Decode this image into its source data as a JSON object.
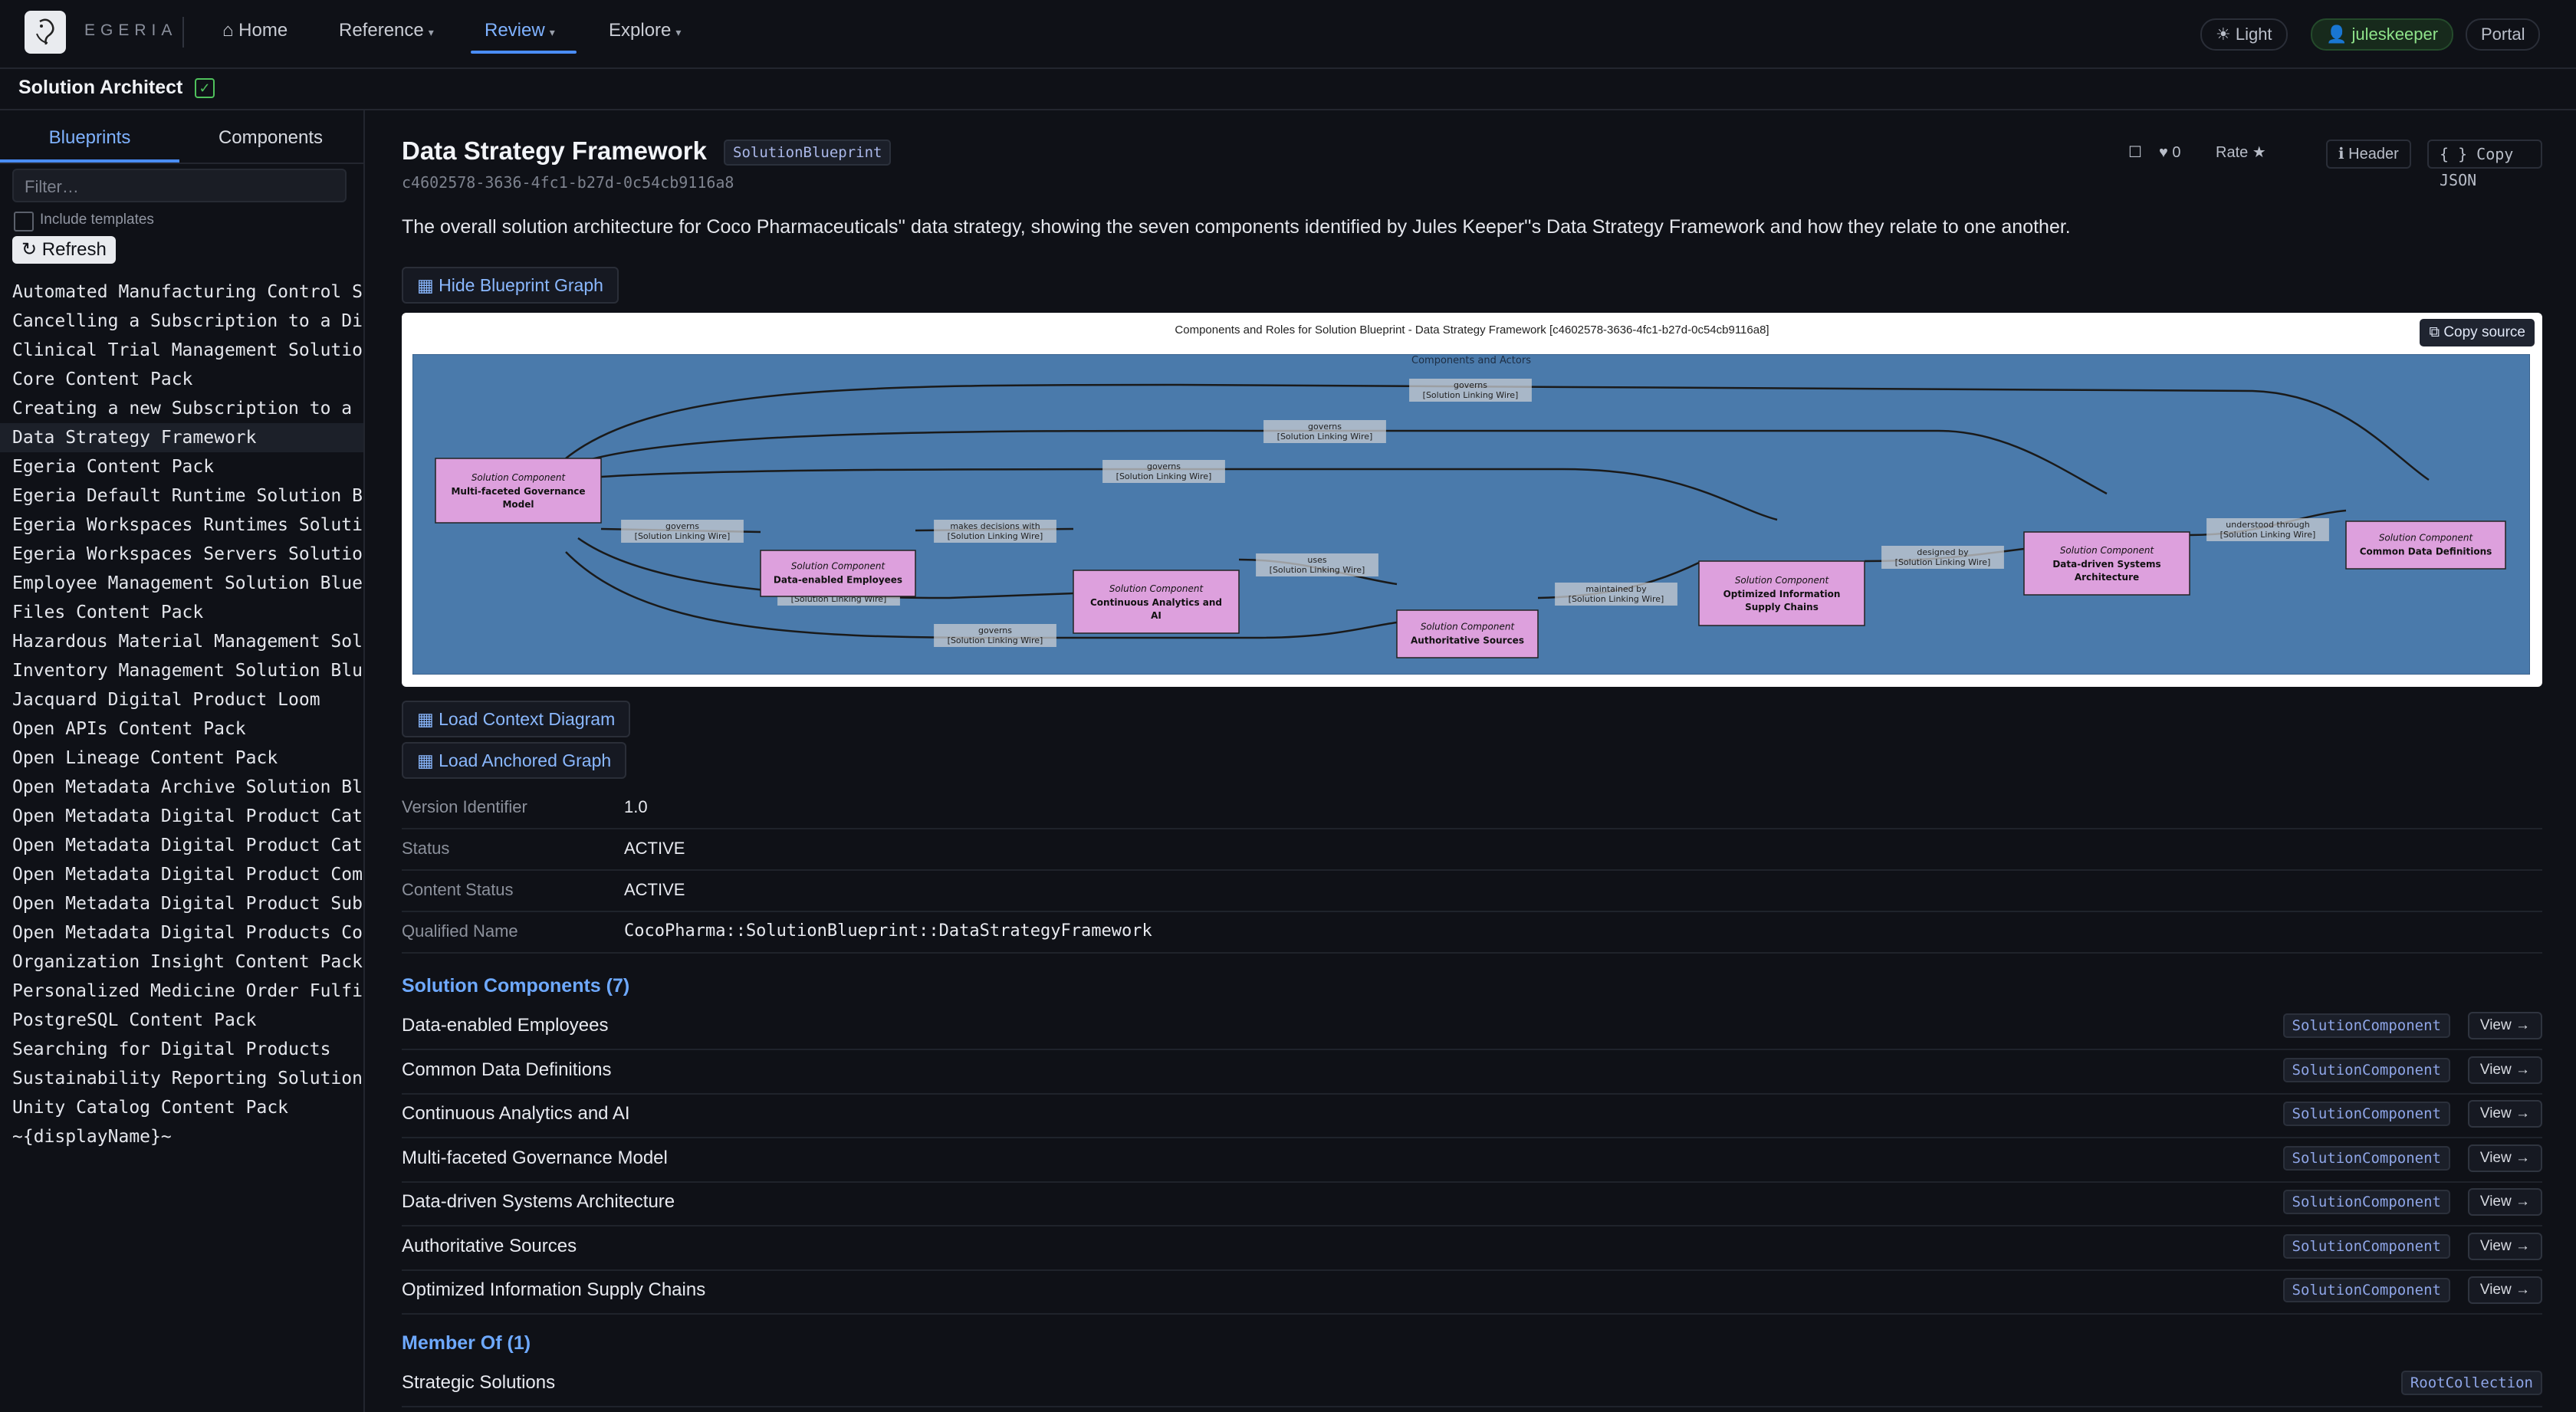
{
  "nav": {
    "brand": "EGERIA",
    "home": "⌂ Home",
    "reference": "Reference",
    "review": "Review",
    "explore": "Explore",
    "caret": "▾",
    "theme": "☀ Light",
    "user": "👤 juleskeeper",
    "portal": "Portal"
  },
  "subheader": {
    "title": "Solution Architect",
    "check": "✓"
  },
  "sidebar": {
    "tabs": [
      "Blueprints",
      "Components"
    ],
    "filter_placeholder": "Filter…",
    "include_templates": "Include templates",
    "refresh": "↻ Refresh",
    "selected_index": 5,
    "items": [
      "Automated Manufacturing Control Sol",
      "Cancelling a Subscription to a Digi",
      "Clinical Trial Management Solution",
      "Core Content Pack",
      "Creating a new Subscription to a Di",
      "Data Strategy Framework",
      "Egeria Content Pack",
      "Egeria Default Runtime Solution Blu",
      "Egeria Workspaces Runtimes Solution",
      "Egeria Workspaces Servers Solution",
      "Employee Management Solution Bluepr",
      "Files Content Pack",
      "Hazardous Material Management Solut",
      "Inventory Management Solution Bluep",
      "Jacquard Digital Product Loom",
      "Open APIs Content Pack",
      "Open Lineage Content Pack",
      "Open Metadata Archive Solution Blue",
      "Open Metadata Digital Product Catal",
      "Open Metadata Digital Product Catal",
      "Open Metadata Digital Product Commu",
      "Open Metadata Digital Product Subsc",
      "Open Metadata Digital Products Cont",
      "Organization Insight Content Pack",
      "Personalized Medicine Order Fulfill",
      "PostgreSQL Content Pack",
      "Searching for Digital Products",
      "Sustainability Reporting Solution E",
      "Unity Catalog Content Pack",
      "~{displayName}~"
    ]
  },
  "detail": {
    "title": "Data Strategy Framework",
    "type": "SolutionBlueprint",
    "guid": "c4602578-3636-4fc1-b27d-0c54cb9116a8",
    "actions": {
      "bookmark": "☐",
      "likes": "♥ 0",
      "rate": "Rate ★",
      "header": "ℹ Header",
      "copy_json": "{ } Copy JSON"
    },
    "description": "The overall solution architecture for Coco Pharmaceuticals'' data strategy, showing the seven components identified by Jules Keeper''s Data Strategy Framework and how they relate to one another.",
    "hide_graph": "▦ Hide Blueprint Graph",
    "load_context": "▦ Load Context Diagram",
    "load_anchored": "▦ Load Anchored Graph",
    "properties": [
      {
        "label": "Version Identifier",
        "value": "1.0"
      },
      {
        "label": "Status",
        "value": "ACTIVE"
      },
      {
        "label": "Content Status",
        "value": "ACTIVE"
      },
      {
        "label": "Qualified Name",
        "value": "CocoPharma::SolutionBlueprint::DataStrategyFramework"
      }
    ],
    "components_title": "Solution Components (7)",
    "components": [
      "Data-enabled Employees",
      "Common Data Definitions",
      "Continuous Analytics and AI",
      "Multi-faceted Governance Model",
      "Data-driven Systems Architecture",
      "Authoritative Sources",
      "Optimized Information Supply Chains"
    ],
    "component_type": "SolutionComponent",
    "view_label": "View →",
    "member_of_title": "Member Of (1)",
    "member_of": [
      {
        "name": "Strategic Solutions",
        "type": "RootCollection"
      }
    ]
  },
  "graph": {
    "title": "Components and Roles for Solution Blueprint - Data Strategy Framework [c4602578-3636-4fc1-b27d-0c54cb9116a8]",
    "copy_source": "⧉ Copy source",
    "subgraph_label": "Components and Actors",
    "node_kind": "Solution Component",
    "colors": {
      "background": "#4a7aab",
      "node_fill": "#dda0dd",
      "edge": "#1a1a1a"
    },
    "nodes": [
      {
        "id": "gov",
        "name": [
          "Multi-faceted Governance",
          "Model"
        ]
      },
      {
        "id": "emp",
        "name": [
          "Data-enabled Employees"
        ]
      },
      {
        "id": "ana",
        "name": [
          "Continuous Analytics and",
          "AI"
        ]
      },
      {
        "id": "src",
        "name": [
          "Authoritative Sources"
        ]
      },
      {
        "id": "opt",
        "name": [
          "Optimized Information",
          "Supply Chains"
        ]
      },
      {
        "id": "arc",
        "name": [
          "Data-driven Systems",
          "Architecture"
        ]
      },
      {
        "id": "cdd",
        "name": [
          "Common Data Definitions"
        ]
      }
    ],
    "edges": [
      {
        "from": "gov",
        "to": "cdd",
        "label": [
          "governs",
          "[Solution Linking Wire]"
        ]
      },
      {
        "from": "gov",
        "to": "arc",
        "label": [
          "governs",
          "[Solution Linking Wire]"
        ]
      },
      {
        "from": "gov",
        "to": "opt",
        "label": [
          "governs",
          "[Solution Linking Wire]"
        ]
      },
      {
        "from": "gov",
        "to": "emp",
        "label": [
          "governs",
          "[Solution Linking Wire]"
        ]
      },
      {
        "from": "gov",
        "to": "ana",
        "label": [
          "governs",
          "[Solution Linking Wire]"
        ]
      },
      {
        "from": "gov",
        "to": "src",
        "label": [
          "governs",
          "[Solution Linking Wire]"
        ]
      },
      {
        "from": "emp",
        "to": "ana",
        "label": [
          "makes decisions with",
          "[Solution Linking Wire]"
        ]
      },
      {
        "from": "ana",
        "to": "src",
        "label": [
          "uses",
          "[Solution Linking Wire]"
        ]
      },
      {
        "from": "src",
        "to": "opt",
        "label": [
          "maintained by",
          "[Solution Linking Wire]"
        ]
      },
      {
        "from": "opt",
        "to": "arc",
        "label": [
          "designed by",
          "[Solution Linking Wire]"
        ]
      },
      {
        "from": "arc",
        "to": "cdd",
        "label": [
          "understood through",
          "[Solution Linking Wire]"
        ]
      }
    ]
  }
}
